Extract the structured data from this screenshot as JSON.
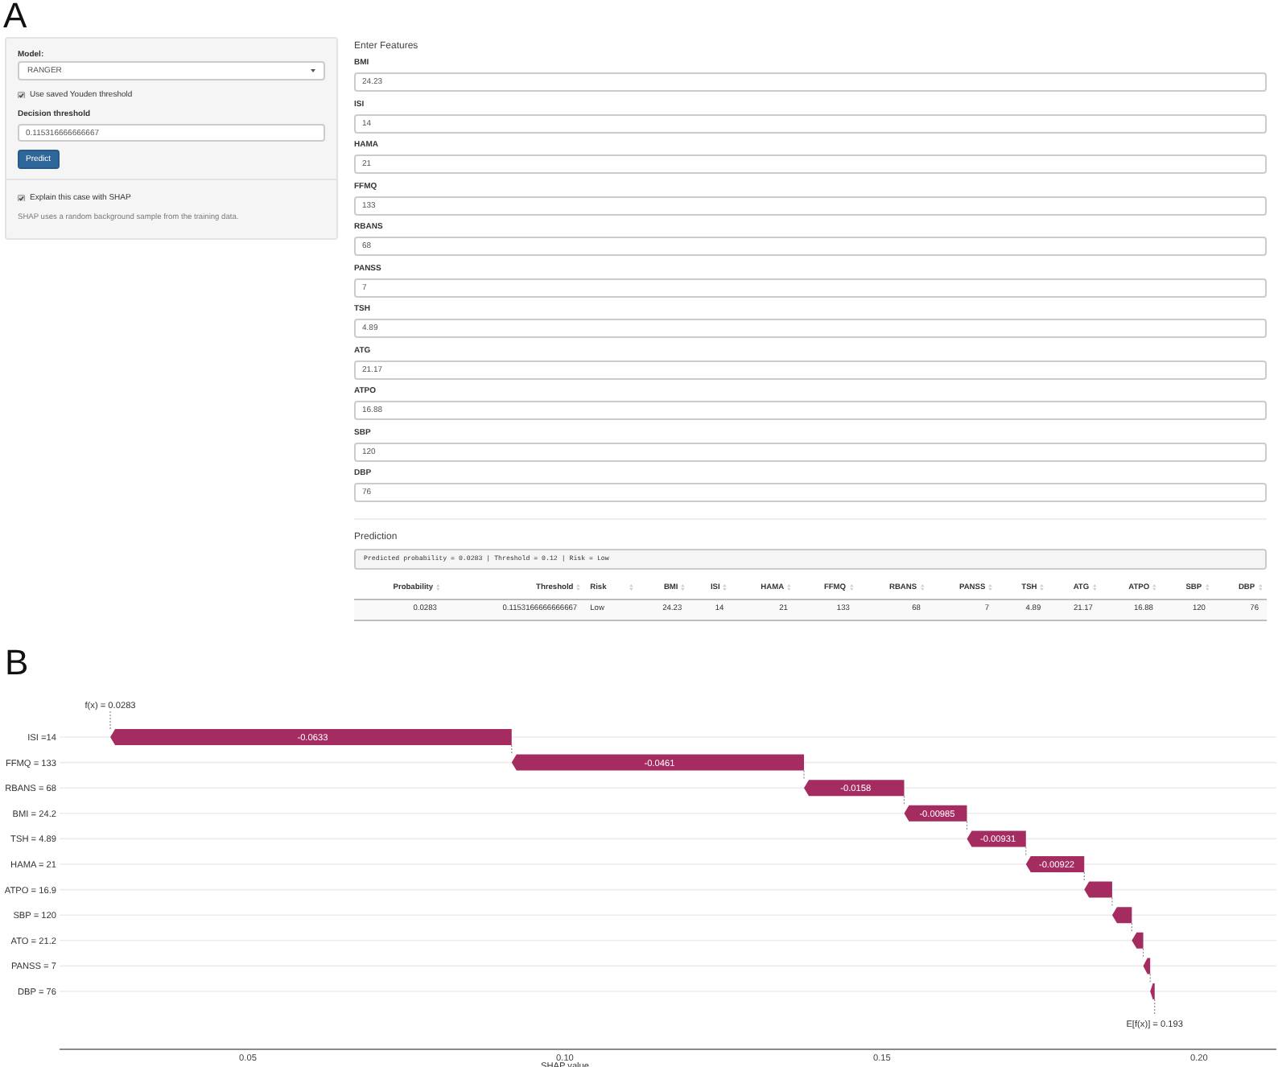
{
  "figure_a": {
    "letter": "A",
    "sidebar": {
      "model": {
        "label": "Model:",
        "value": "RANGER"
      },
      "youden": {
        "label": "Use saved Youden threshold",
        "checked": true
      },
      "threshold": {
        "label": "Decision threshold",
        "value": "0.115316666666667"
      },
      "predict_button": "Predict",
      "shap": {
        "label": "Explain this case with SHAP",
        "checked": true
      },
      "help_text": "SHAP uses a random background sample from the training data."
    },
    "features": {
      "title": "Enter Features",
      "fields": [
        {
          "label": "BMI",
          "value": "24.23"
        },
        {
          "label": "ISI",
          "value": "14"
        },
        {
          "label": "HAMA",
          "value": "21"
        },
        {
          "label": "FFMQ",
          "value": "133"
        },
        {
          "label": "RBANS",
          "value": "68"
        },
        {
          "label": "PANSS",
          "value": "7"
        },
        {
          "label": "TSH",
          "value": "4.89"
        },
        {
          "label": "ATG",
          "value": "21.17"
        },
        {
          "label": "ATPO",
          "value": "16.88"
        },
        {
          "label": "SBP",
          "value": "120"
        },
        {
          "label": "DBP",
          "value": "76"
        }
      ]
    },
    "prediction": {
      "title": "Prediction",
      "output": "Predicted probability = 0.0283 | Threshold = 0.12 | Risk = Low",
      "table": {
        "columns": [
          {
            "label": "Probability",
            "kind": "number"
          },
          {
            "label": "Threshold",
            "kind": "number"
          },
          {
            "label": "Risk",
            "kind": "text"
          },
          {
            "label": "BMI",
            "kind": "number"
          },
          {
            "label": "ISI",
            "kind": "number"
          },
          {
            "label": "HAMA",
            "kind": "number"
          },
          {
            "label": "FFMQ",
            "kind": "number"
          },
          {
            "label": "RBANS",
            "kind": "number"
          },
          {
            "label": "PANSS",
            "kind": "number"
          },
          {
            "label": "TSH",
            "kind": "number"
          },
          {
            "label": "ATG",
            "kind": "number"
          },
          {
            "label": "ATPO",
            "kind": "number"
          },
          {
            "label": "SBP",
            "kind": "number"
          },
          {
            "label": "DBP",
            "kind": "number"
          }
        ],
        "rows": [
          [
            "0.0283",
            "0.1153166666666667",
            "Low",
            "24.23",
            "14",
            "21",
            "133",
            "68",
            "7",
            "4.89",
            "21.17",
            "16.88",
            "120",
            "76"
          ]
        ]
      }
    }
  },
  "figure_b": {
    "letter": "B",
    "chart_data": {
      "type": "candlestick",
      "orientation": "horizontal",
      "xlabel": "SHAP value",
      "categories": [
        "ISI =14",
        "FFMQ = 133",
        "RBANS = 68",
        "BMI = 24.2",
        "TSH = 4.89",
        "HAMA = 21",
        "ATPO = 16.9",
        "SBP = 120",
        "ATO = 21.2",
        "PANSS = 7",
        "DBP = 76"
      ],
      "ohlc": [
        [
          0.0916,
          0.0916,
          0.0283,
          0.0283
        ],
        [
          0.1377,
          0.1377,
          0.0916,
          0.0916
        ],
        [
          0.1535,
          0.1535,
          0.1377,
          0.1377
        ],
        [
          0.1634,
          0.1634,
          0.1535,
          0.1535
        ],
        [
          0.1727,
          0.1727,
          0.1634,
          0.1634
        ],
        [
          0.1819,
          0.1819,
          0.1727,
          0.1727
        ],
        [
          0.1863,
          0.1863,
          0.1819,
          0.1819
        ],
        [
          0.1894,
          0.1894,
          0.1863,
          0.1863
        ],
        [
          0.1912,
          0.1912,
          0.1894,
          0.1894
        ],
        [
          0.1923,
          0.1923,
          0.1912,
          0.1912
        ],
        [
          0.193,
          0.193,
          0.1923,
          0.1923
        ]
      ],
      "value_labels": [
        "-0.0633",
        "-0.0461",
        "-0.0158",
        "-0.00985",
        "-0.00931",
        "-0.00922",
        null,
        null,
        null,
        null,
        null
      ],
      "xlim": [
        0.0203,
        0.2122
      ],
      "xticks": [
        {
          "value": 0.05,
          "label": "0.05"
        },
        {
          "value": 0.1,
          "label": "0.10"
        },
        {
          "value": 0.15,
          "label": "0.15"
        },
        {
          "value": 0.2,
          "label": "0.20"
        }
      ],
      "grid": true,
      "annotations": [
        "f(x) = 0.0283",
        "E[f(x)] = 0.193"
      ]
    }
  }
}
